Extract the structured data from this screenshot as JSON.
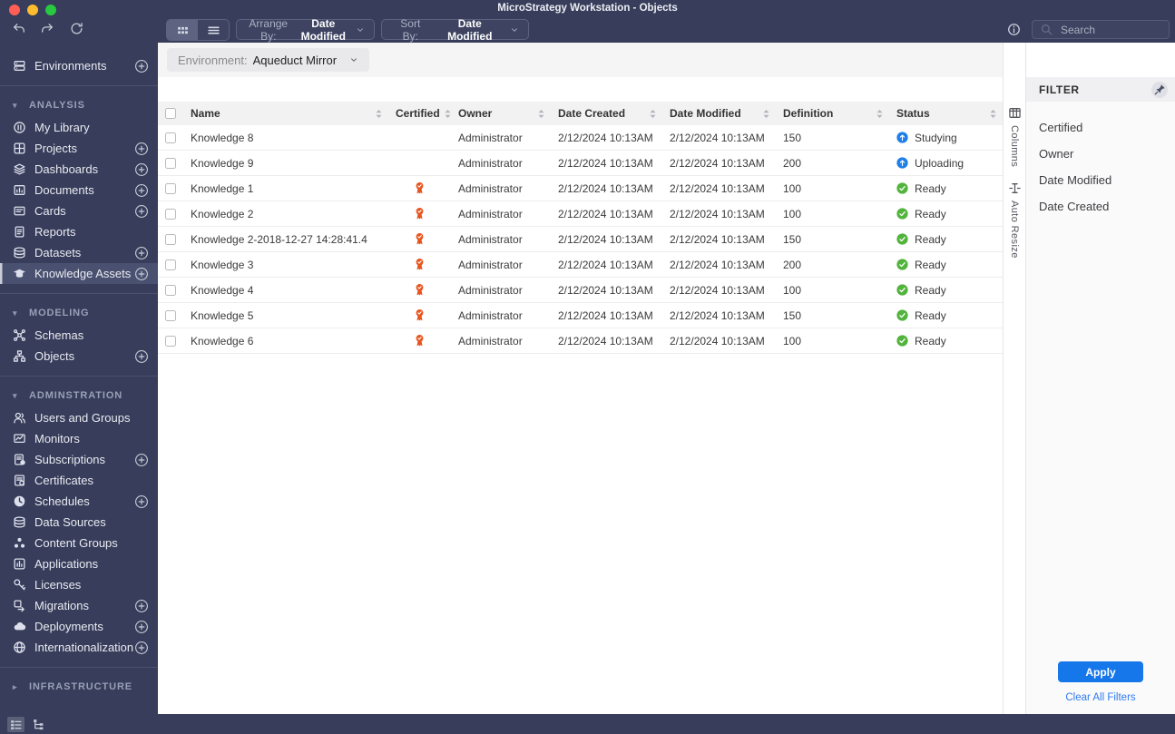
{
  "window": {
    "title": "MicroStrategy Workstation - Objects",
    "traffic_lights": [
      "#ff5f57",
      "#febc2e",
      "#28c840"
    ]
  },
  "toolbar": {
    "arrange_by": {
      "label": "Arrange By:",
      "value": "Date Modified"
    },
    "sort_by": {
      "label": "Sort By:",
      "value": "Date Modified"
    },
    "search": {
      "placeholder": "Search"
    }
  },
  "environment_bar": {
    "label": "Environment:",
    "value": "Aqueduct Mirror"
  },
  "sidebar": {
    "sections": [
      {
        "items": [
          {
            "label": "Environments",
            "icon": "environments-icon",
            "add": true
          }
        ]
      },
      {
        "header": "ANALYSIS",
        "expanded": true,
        "items": [
          {
            "label": "My Library",
            "icon": "my-library-icon"
          },
          {
            "label": "Projects",
            "icon": "projects-icon",
            "add": true
          },
          {
            "label": "Dashboards",
            "icon": "dashboards-icon",
            "add": true
          },
          {
            "label": "Documents",
            "icon": "documents-icon",
            "add": true
          },
          {
            "label": "Cards",
            "icon": "cards-icon",
            "add": true
          },
          {
            "label": "Reports",
            "icon": "reports-icon"
          },
          {
            "label": "Datasets",
            "icon": "datasets-icon",
            "add": true
          },
          {
            "label": "Knowledge Assets",
            "icon": "knowledge-assets-icon",
            "add": true,
            "selected": true
          }
        ]
      },
      {
        "header": "MODELING",
        "expanded": true,
        "items": [
          {
            "label": "Schemas",
            "icon": "schemas-icon"
          },
          {
            "label": "Objects",
            "icon": "objects-icon",
            "add": true
          }
        ]
      },
      {
        "header": "ADMINSTRATION",
        "expanded": true,
        "items": [
          {
            "label": "Users and Groups",
            "icon": "users-icon"
          },
          {
            "label": "Monitors",
            "icon": "monitors-icon"
          },
          {
            "label": "Subscriptions",
            "icon": "subscriptions-icon",
            "add": true
          },
          {
            "label": "Certificates",
            "icon": "certificates-icon"
          },
          {
            "label": "Schedules",
            "icon": "schedules-icon",
            "add": true
          },
          {
            "label": "Data Sources",
            "icon": "data-sources-icon"
          },
          {
            "label": "Content Groups",
            "icon": "content-groups-icon"
          },
          {
            "label": "Applications",
            "icon": "applications-icon"
          },
          {
            "label": "Licenses",
            "icon": "licenses-icon"
          },
          {
            "label": "Migrations",
            "icon": "migrations-icon",
            "add": true
          },
          {
            "label": "Deployments",
            "icon": "deployments-icon",
            "add": true
          },
          {
            "label": "Internationalization",
            "icon": "internationalization-icon",
            "add": true
          }
        ]
      },
      {
        "header": "INFRASTRUCTURE",
        "expanded": false,
        "items": []
      }
    ]
  },
  "table": {
    "columns": [
      "Name",
      "Certified",
      "Owner",
      "Date Created",
      "Date Modified",
      "Definition",
      "Status"
    ],
    "rows": [
      {
        "name": "Knowledge 8",
        "certified": false,
        "owner": "Administrator",
        "date_created": "2/12/2024 10:13AM",
        "date_modified": "2/12/2024 10:13AM",
        "definition": "150",
        "status": "Studying",
        "status_kind": "progress"
      },
      {
        "name": "Knowledge 9",
        "certified": false,
        "owner": "Administrator",
        "date_created": "2/12/2024 10:13AM",
        "date_modified": "2/12/2024 10:13AM",
        "definition": "200",
        "status": "Uploading",
        "status_kind": "progress"
      },
      {
        "name": "Knowledge 1",
        "certified": true,
        "owner": "Administrator",
        "date_created": "2/12/2024 10:13AM",
        "date_modified": "2/12/2024 10:13AM",
        "definition": "100",
        "status": "Ready",
        "status_kind": "ok"
      },
      {
        "name": "Knowledge 2",
        "certified": true,
        "owner": "Administrator",
        "date_created": "2/12/2024 10:13AM",
        "date_modified": "2/12/2024 10:13AM",
        "definition": "100",
        "status": "Ready",
        "status_kind": "ok"
      },
      {
        "name": "Knowledge 2-2018-12-27 14:28:41.4",
        "certified": true,
        "owner": "Administrator",
        "date_created": "2/12/2024 10:13AM",
        "date_modified": "2/12/2024 10:13AM",
        "definition": "150",
        "status": "Ready",
        "status_kind": "ok"
      },
      {
        "name": "Knowledge 3",
        "certified": true,
        "owner": "Administrator",
        "date_created": "2/12/2024 10:13AM",
        "date_modified": "2/12/2024 10:13AM",
        "definition": "200",
        "status": "Ready",
        "status_kind": "ok"
      },
      {
        "name": "Knowledge 4",
        "certified": true,
        "owner": "Administrator",
        "date_created": "2/12/2024 10:13AM",
        "date_modified": "2/12/2024 10:13AM",
        "definition": "100",
        "status": "Ready",
        "status_kind": "ok"
      },
      {
        "name": "Knowledge 5",
        "certified": true,
        "owner": "Administrator",
        "date_created": "2/12/2024 10:13AM",
        "date_modified": "2/12/2024 10:13AM",
        "definition": "150",
        "status": "Ready",
        "status_kind": "ok"
      },
      {
        "name": "Knowledge 6",
        "certified": true,
        "owner": "Administrator",
        "date_created": "2/12/2024 10:13AM",
        "date_modified": "2/12/2024 10:13AM",
        "definition": "100",
        "status": "Ready",
        "status_kind": "ok"
      }
    ]
  },
  "rail": {
    "columns_label": "Columns",
    "auto_resize_label": "Auto Resize"
  },
  "filter_panel": {
    "title": "FILTER",
    "items": [
      "Certified",
      "Owner",
      "Date Modified",
      "Date Created"
    ],
    "apply_label": "Apply",
    "clear_label": "Clear All Filters"
  },
  "colors": {
    "accent_blue": "#1677eb",
    "link_blue": "#2f7af0",
    "status_ready_green": "#52b43c",
    "status_progress_blue": "#1d7fe8",
    "certified_orange": "#e8551e"
  }
}
